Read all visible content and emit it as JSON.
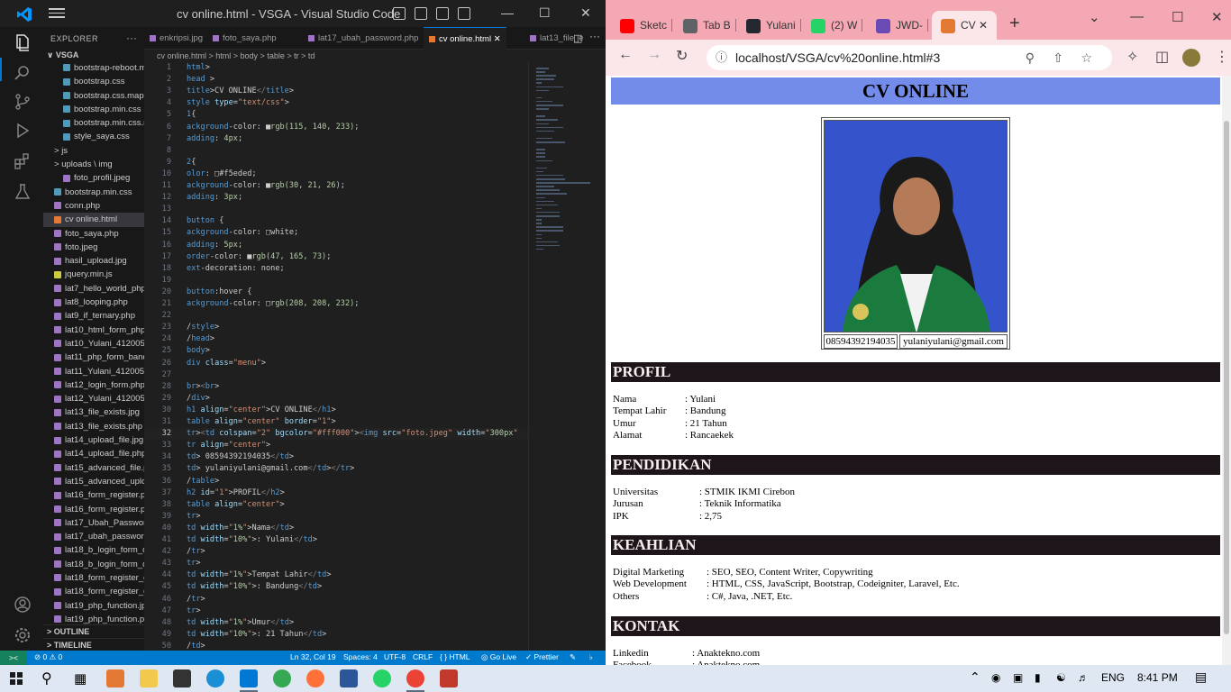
{
  "vscode": {
    "title": "cv online.html - VSGA - Visual Studio Code",
    "explorer_header": "EXPLORER",
    "explorer_more": "···",
    "root_folder": "VSGA",
    "files": [
      {
        "name": "bootstrap-reboot.mi...",
        "indent": 2,
        "color": "#519aba"
      },
      {
        "name": "bootstrap.css",
        "indent": 2,
        "color": "#519aba"
      },
      {
        "name": "bootstrap.css.map",
        "indent": 2,
        "color": "#519aba"
      },
      {
        "name": "bootstrap.min.css",
        "indent": 2,
        "color": "#519aba"
      },
      {
        "name": "bootstrap.min.css.m...",
        "indent": 2,
        "color": "#519aba"
      },
      {
        "name": "style_saya.css",
        "indent": 2,
        "color": "#519aba"
      },
      {
        "name": "js",
        "indent": 1,
        "color": "",
        "folder": true
      },
      {
        "name": "uploads \\ img",
        "indent": 1,
        "color": "",
        "folder": true
      },
      {
        "name": "foto_profil.jpeg",
        "indent": 2,
        "color": "#a074c4"
      },
      {
        "name": "bootstrap.min.css",
        "indent": 1,
        "color": "#519aba"
      },
      {
        "name": "conn.php",
        "indent": 1,
        "color": "#a074c4"
      },
      {
        "name": "cv online.html",
        "indent": 1,
        "color": "#e37933",
        "selected": true
      },
      {
        "name": "foto_saya.php",
        "indent": 1,
        "color": "#a074c4"
      },
      {
        "name": "foto.jpeg",
        "indent": 1,
        "color": "#a074c4"
      },
      {
        "name": "hasil_upload.jpg",
        "indent": 1,
        "color": "#a074c4"
      },
      {
        "name": "jquery.min.js",
        "indent": 1,
        "color": "#cbcb41"
      },
      {
        "name": "lat7_hello_world_php....",
        "indent": 1,
        "color": "#a074c4"
      },
      {
        "name": "lat8_looping.php",
        "indent": 1,
        "color": "#a074c4"
      },
      {
        "name": "lat9_if_ternary.php",
        "indent": 1,
        "color": "#a074c4"
      },
      {
        "name": "lat10_html_form_php....",
        "indent": 1,
        "color": "#a074c4"
      },
      {
        "name": "lat10_Yulani_4120054...",
        "indent": 1,
        "color": "#a074c4"
      },
      {
        "name": "lat11_php_form_band...",
        "indent": 1,
        "color": "#a074c4"
      },
      {
        "name": "lat11_Yulani_4120054...",
        "indent": 1,
        "color": "#a074c4"
      },
      {
        "name": "lat12_login_form.php",
        "indent": 1,
        "color": "#a074c4"
      },
      {
        "name": "lat12_Yulani_4120054...",
        "indent": 1,
        "color": "#a074c4"
      },
      {
        "name": "lat13_file_exists.jpg",
        "indent": 1,
        "color": "#a074c4"
      },
      {
        "name": "lat13_file_exists.php",
        "indent": 1,
        "color": "#a074c4"
      },
      {
        "name": "lat14_upload_file.jpg",
        "indent": 1,
        "color": "#a074c4"
      },
      {
        "name": "lat14_upload_file.php",
        "indent": 1,
        "color": "#a074c4"
      },
      {
        "name": "lat15_advanced_file.p...",
        "indent": 1,
        "color": "#a074c4"
      },
      {
        "name": "lat15_advanced_uploa...",
        "indent": 1,
        "color": "#a074c4"
      },
      {
        "name": "lat16_form_register.php",
        "indent": 1,
        "color": "#a074c4"
      },
      {
        "name": "lat16_form_register.png",
        "indent": 1,
        "color": "#a074c4"
      },
      {
        "name": "lat17_Ubah_Password....",
        "indent": 1,
        "color": "#a074c4"
      },
      {
        "name": "lat17_ubah_password....",
        "indent": 1,
        "color": "#a074c4"
      },
      {
        "name": "lat18_b_login_form_d...",
        "indent": 1,
        "color": "#a074c4"
      },
      {
        "name": "lat18_b_login_form_d...",
        "indent": 1,
        "color": "#a074c4"
      },
      {
        "name": "lat18_form_register_d...",
        "indent": 1,
        "color": "#a074c4"
      },
      {
        "name": "lat18_form_register_d...",
        "indent": 1,
        "color": "#a074c4"
      },
      {
        "name": "lat19_php_function.jpg",
        "indent": 1,
        "color": "#a074c4"
      },
      {
        "name": "lat19_php_function.php",
        "indent": 1,
        "color": "#a074c4"
      }
    ],
    "outline_label": "OUTLINE",
    "timeline_label": "TIMELINE",
    "tabs": [
      {
        "label": "enkripsi.jpg",
        "active": false
      },
      {
        "label": "foto_saya.php",
        "active": false
      },
      {
        "label": "lat17_ubah_password.php",
        "active": false
      },
      {
        "label": "cv online.html",
        "active": true
      },
      {
        "label": "lat13_file_e",
        "active": false
      }
    ],
    "breadcrumb": "cv online.html > html > body > table > tr > td",
    "current_line": 32,
    "code_lines": [
      "html>",
      "head >",
      "title>CV ONLINE</title>",
      "style type=\"text/css\">",
      "1{",
      "ackground-color: ■rgb(115, 140, 233);",
      "adding: 4px;",
      "",
      "2{",
      "olor: □#f5eded;",
      "ackground-color: ■rgb(30, 21, 26);",
      "adding: 3px;",
      "",
      "button {",
      "ackground-color: □white;",
      "adding: 5px;",
      "order-color: ■rgb(47, 165, 73);",
      "ext-decoration: none;",
      "",
      "button:hover {",
      "ackground-color: □rgb(208, 208, 232);",
      "",
      "/style>",
      "/head>",
      "body>",
      "div class=\"menu\">",
      "",
      "br><br>",
      "/div>",
      "h1 align=\"center\">CV ONLINE</h1>",
      "table align=\"center\" border=\"1\">",
      "tr><td colspan=\"2\" bgcolor=\"#fff000\"><img src=\"foto.jpeg\" width=\"300px\"",
      "tr align=\"center\">",
      "td> 08594392194035</td>",
      "td> yulaniyulani@gmail.com</td></tr>",
      "/table>",
      "h2 id=\"1\">PROFIL</h2>",
      "table align=\"center\">",
      "tr>",
      "td width=\"1%\">Nama</td>",
      "td width=\"10%\">: Yulani</td>",
      "/tr>",
      "tr>",
      "td width=\"1%\">Tempat Lahir</td>",
      "td width=\"10%\">: Bandung</td>",
      "/tr>",
      "tr>",
      "td width=\"1%\">Umur</td>",
      "td width=\"10%\">: 21 Tahun</td>",
      "/td>"
    ],
    "status": {
      "remote": "><",
      "problems": "⊘ 0 ⚠ 0",
      "cursor": "Ln 32, Col 19",
      "spaces": "Spaces: 4",
      "encoding": "UTF-8",
      "eol": "CRLF",
      "language": "{ } HTML",
      "golive": "◎ Go Live",
      "prettier": "✓ Prettier"
    }
  },
  "chrome": {
    "tabs": [
      {
        "label": "Sketc",
        "favicon_color": "#ff0000"
      },
      {
        "label": "Tab B",
        "favicon_color": "#5f6368"
      },
      {
        "label": "Yulani",
        "favicon_color": "#24292f"
      },
      {
        "label": "(2) W",
        "favicon_color": "#25d366"
      },
      {
        "label": "JWD-",
        "favicon_color": "#6a4ab5"
      },
      {
        "label": "CV",
        "favicon_color": "#e37933",
        "active": true
      }
    ],
    "new_tab": "+",
    "url": "localhost/VSGA/cv%20online.html#3",
    "page": {
      "title": "CV ONLINE",
      "phone": "08594392194035",
      "email": "yulaniyulani@gmail.com",
      "sections": [
        {
          "heading": "PROFIL",
          "rows": [
            {
              "label": "Nama",
              "value": ": Yulani"
            },
            {
              "label": "Tempat Lahir",
              "value": ": Bandung"
            },
            {
              "label": "Umur",
              "value": ": 21 Tahun"
            },
            {
              "label": "Alamat",
              "value": ": Rancaekek"
            }
          ]
        },
        {
          "heading": "PENDIDIKAN",
          "rows": [
            {
              "label": "Universitas",
              "value": ": STMIK IKMI Cirebon"
            },
            {
              "label": "Jurusan",
              "value": ": Teknik Informatika"
            },
            {
              "label": "IPK",
              "value": ": 2,75"
            }
          ]
        },
        {
          "heading": "KEAHLIAN",
          "rows": [
            {
              "label": "Digital Marketing",
              "value": ": SEO, SEO, Content Writer, Copywriting"
            },
            {
              "label": "Web Development",
              "value": ": HTML, CSS, JavaScript, Bootstrap, Codeigniter, Laravel, Etc."
            },
            {
              "label": "Others",
              "value": ": C#, Java, .NET, Etc."
            }
          ]
        },
        {
          "heading": "KONTAK",
          "rows": [
            {
              "label": "Linkedin",
              "value": ": Anaktekno.com"
            },
            {
              "label": "Facebook",
              "value": ": Anaktekno.com"
            }
          ]
        }
      ]
    }
  },
  "taskbar": {
    "language": "ENG",
    "time": "8:41 PM"
  }
}
